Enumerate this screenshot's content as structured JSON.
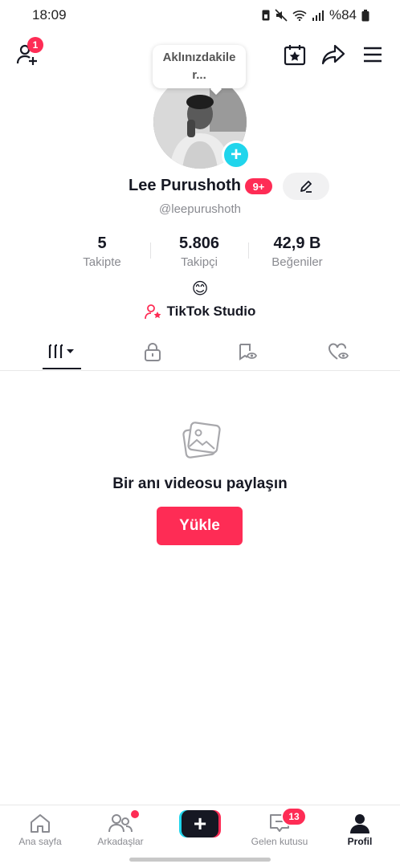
{
  "status_bar": {
    "time": "18:09",
    "battery": "%84"
  },
  "header": {
    "add_friend_badge": "1"
  },
  "profile": {
    "bubble_text": "Aklınızdakiler...",
    "name": "Lee Purushoth",
    "name_badge": "9+",
    "handle": "@leepurushoth",
    "stats": [
      {
        "value": "5",
        "label": "Takipte"
      },
      {
        "value": "5.806",
        "label": "Takipçi"
      },
      {
        "value": "42,9 B",
        "label": "Beğeniler"
      }
    ],
    "bio_emoji": "😊",
    "studio_label": "TikTok Studio"
  },
  "empty_state": {
    "title": "Bir anı videosu paylaşın",
    "button": "Yükle"
  },
  "bottom_nav": {
    "items": [
      {
        "label": "Ana sayfa"
      },
      {
        "label": "Arkadaşlar"
      },
      {
        "label": ""
      },
      {
        "label": "Gelen kutusu",
        "badge": "13"
      },
      {
        "label": "Profil"
      }
    ]
  },
  "colors": {
    "accent": "#fe2c55",
    "cyan": "#20d5ec",
    "text": "#161823",
    "muted": "#8a8b91"
  }
}
